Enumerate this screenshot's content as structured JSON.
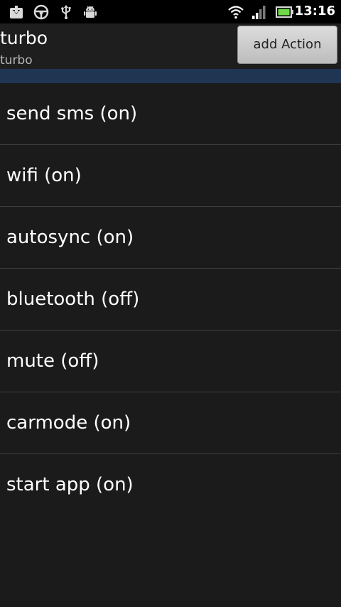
{
  "status_bar": {
    "icons": [
      "download-icon",
      "steering-wheel-icon",
      "usb-icon",
      "android-debug-icon",
      "wifi-icon",
      "signal-icon",
      "battery-icon"
    ],
    "time": "13:16"
  },
  "header": {
    "title": "turbo",
    "subtitle": "turbo",
    "add_action_label": "add Action"
  },
  "actions": [
    {
      "label": "send sms (on)"
    },
    {
      "label": "wifi (on)"
    },
    {
      "label": "autosync (on)"
    },
    {
      "label": "bluetooth (off)"
    },
    {
      "label": "mute (off)"
    },
    {
      "label": "carmode (on)"
    },
    {
      "label": "start app (on)"
    }
  ],
  "colors": {
    "accent_bar": "#1f3552",
    "battery": "#6fd94a"
  }
}
